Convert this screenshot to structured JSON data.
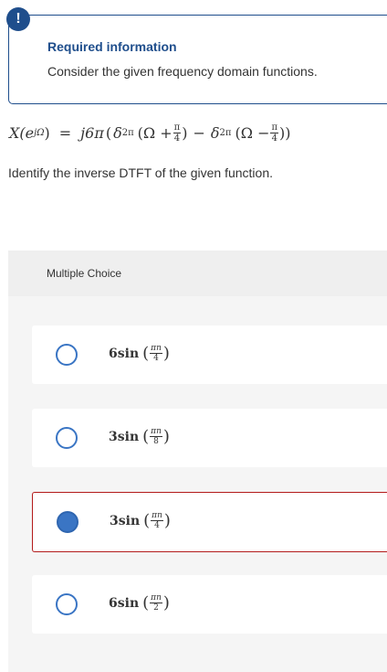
{
  "alert": {
    "icon": "exclamation-icon",
    "symbol": "!"
  },
  "info": {
    "title": "Required information",
    "text": "Consider the given frequency domain functions."
  },
  "equation": {
    "lhs": "X(e",
    "lhs_sup": "jΩ",
    "lhs_close": ")",
    "equals": "=",
    "coef": "j6π",
    "open": "(",
    "delta1": "δ",
    "delta1_sub": "2π",
    "arg1_open": "(Ω +",
    "frac1_num": "π",
    "frac1_den": "4",
    "arg1_close": ")",
    "minus": "−",
    "delta2": "δ",
    "delta2_sub": "2π",
    "arg2_open": "(Ω −",
    "frac2_num": "π",
    "frac2_den": "4",
    "arg2_close": "))"
  },
  "question": "Identify the inverse DTFT of the given function.",
  "multiple_choice": {
    "label": "Multiple Choice",
    "choices": [
      {
        "coef": "6sin",
        "num": "πn",
        "den": "4",
        "selected": false
      },
      {
        "coef": "3sin",
        "num": "πn",
        "den": "8",
        "selected": false
      },
      {
        "coef": "3sin",
        "num": "πn",
        "den": "4",
        "selected": true
      },
      {
        "coef": "6sin",
        "num": "πn",
        "den": "2",
        "selected": false
      }
    ]
  },
  "colors": {
    "accent": "#1f4e8c",
    "radio": "#3a75c4",
    "selected_border": "#b31b1b"
  }
}
